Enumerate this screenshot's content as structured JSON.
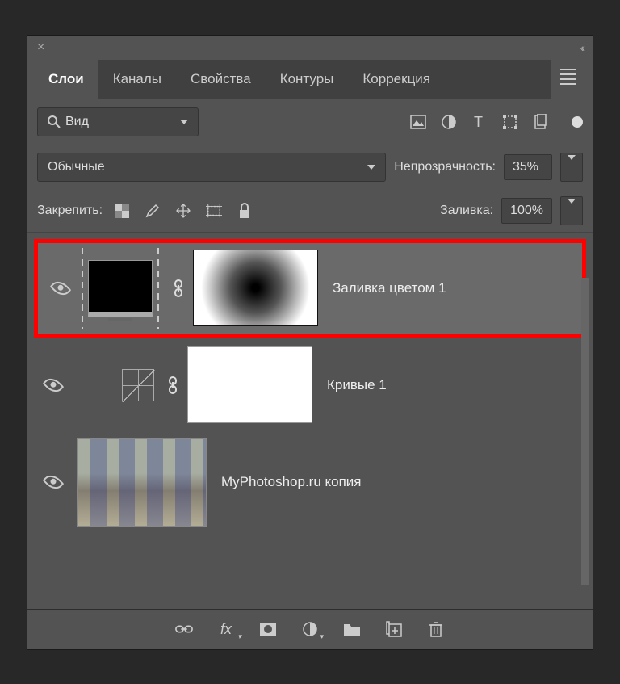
{
  "titlebar": {
    "close": "×",
    "collapse": "‹‹"
  },
  "tabs": [
    {
      "label": "Слои",
      "active": true
    },
    {
      "label": "Каналы",
      "active": false
    },
    {
      "label": "Свойства",
      "active": false
    },
    {
      "label": "Контуры",
      "active": false
    },
    {
      "label": "Коррекция",
      "active": false
    }
  ],
  "filter": {
    "kind": "Вид",
    "icons": [
      "image",
      "adjust",
      "text",
      "shape",
      "smart"
    ]
  },
  "blend": {
    "mode": "Обычные",
    "opacity_label": "Непрозрачность:",
    "opacity_value": "35%"
  },
  "lock": {
    "label": "Закрепить:",
    "fill_label": "Заливка:",
    "fill_value": "100%"
  },
  "layers": [
    {
      "name": "Заливка цветом 1",
      "type": "fill",
      "highlighted": true,
      "has_mask": true
    },
    {
      "name": "Кривые 1",
      "type": "curves",
      "highlighted": false,
      "has_mask": true
    },
    {
      "name": "MyPhotoshop.ru копия",
      "type": "image",
      "highlighted": false,
      "has_mask": false
    }
  ],
  "bottom": {
    "icons": [
      "link",
      "fx",
      "mask",
      "adjust",
      "group",
      "new",
      "trash"
    ],
    "fx_label": "fx"
  }
}
